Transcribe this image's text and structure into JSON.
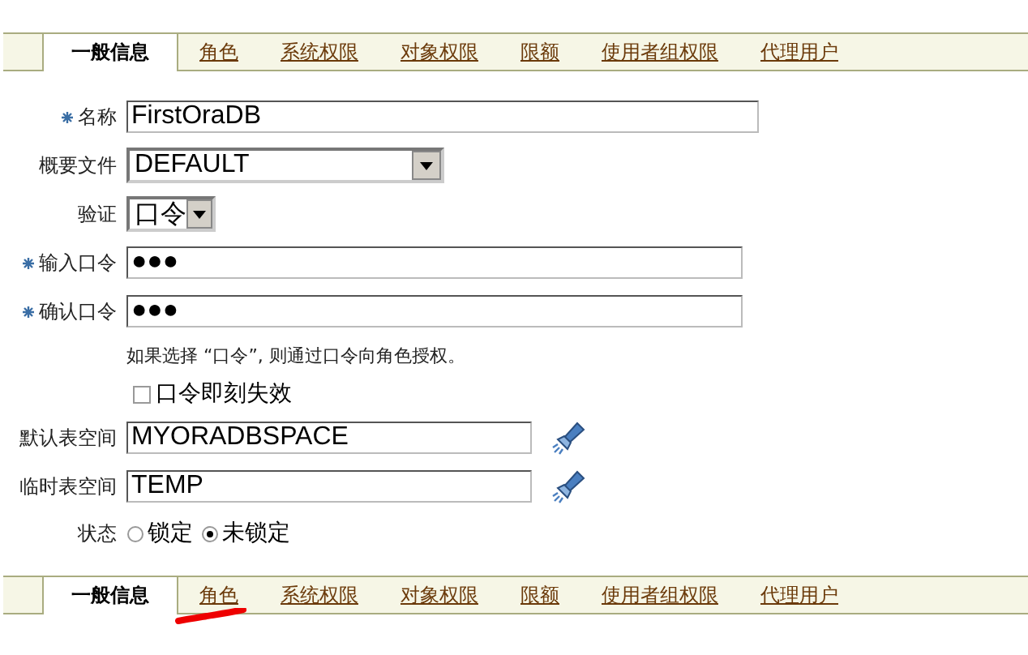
{
  "top_tabs": [
    {
      "label": "一般信息",
      "selected": true,
      "marked": false
    },
    {
      "label": "角色",
      "selected": false,
      "marked": false
    },
    {
      "label": "系统权限",
      "selected": false,
      "marked": false
    },
    {
      "label": "对象权限",
      "selected": false,
      "marked": false
    },
    {
      "label": "限额",
      "selected": false,
      "marked": false
    },
    {
      "label": "使用者组权限",
      "selected": false,
      "marked": false
    },
    {
      "label": "代理用户",
      "selected": false,
      "marked": false
    }
  ],
  "form": [
    {
      "kind": "text",
      "label": "名称",
      "required": true,
      "value": "FirstOraDB"
    },
    {
      "kind": "select",
      "label": "概要文件",
      "required": false,
      "value": "DEFAULT"
    },
    {
      "kind": "select",
      "label": "验证",
      "required": false,
      "value": "口令"
    },
    {
      "kind": "password",
      "label": "输入口令",
      "required": true,
      "value": "●●●"
    },
    {
      "kind": "password",
      "label": "确认口令",
      "required": true,
      "value": "●●●"
    },
    {
      "kind": "hint",
      "text": "如果选择 “口令”, 则通过口令向角色授权。"
    },
    {
      "kind": "checkbox",
      "label": "口令即刻失效",
      "checked": false
    },
    {
      "kind": "lookup",
      "label": "默认表空间",
      "required": false,
      "value": "MYORADBSPACE"
    },
    {
      "kind": "lookup",
      "label": "临时表空间",
      "required": false,
      "value": "TEMP"
    },
    {
      "kind": "radio",
      "label": "状态",
      "options": [
        {
          "label": "锁定",
          "selected": false
        },
        {
          "label": "未锁定",
          "selected": true
        }
      ]
    }
  ],
  "bottom_tabs": [
    {
      "label": "一般信息",
      "selected": true,
      "marked": false
    },
    {
      "label": "角色",
      "selected": false,
      "marked": true
    },
    {
      "label": "系统权限",
      "selected": false,
      "marked": false
    },
    {
      "label": "对象权限",
      "selected": false,
      "marked": false
    },
    {
      "label": "限额",
      "selected": false,
      "marked": false
    },
    {
      "label": "使用者组权限",
      "selected": false,
      "marked": false
    },
    {
      "label": "代理用户",
      "selected": false,
      "marked": false
    }
  ]
}
